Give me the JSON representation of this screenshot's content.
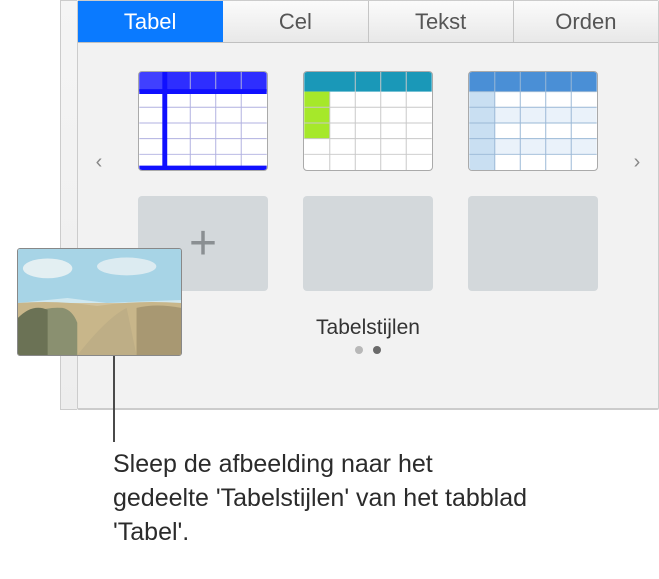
{
  "tabs": {
    "tabel": "Tabel",
    "cel": "Cel",
    "tekst": "Tekst",
    "orden": "Orden"
  },
  "icons": {
    "chevron_left": "‹",
    "chevron_right": "›",
    "plus": "+"
  },
  "section_title": "Tabelstijlen",
  "callout": "Sleep de afbeelding naar het gedeelte 'Tabelstijlen' van het tabblad 'Tabel'."
}
